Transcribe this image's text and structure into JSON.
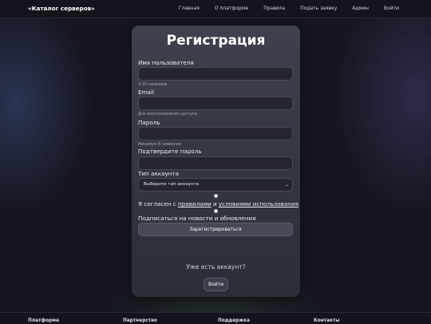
{
  "nav": {
    "brand": "«Каталог серверов»",
    "items": [
      "Главная",
      "О платформе",
      "Правила",
      "Подать заявку",
      "Админ",
      "Войти"
    ]
  },
  "form": {
    "title": "Регистрация",
    "username": {
      "label": "Имя пользователя",
      "hint": "3-20 символов",
      "value": ""
    },
    "email": {
      "label": "Email",
      "hint": "Для восстановления доступа",
      "value": ""
    },
    "password": {
      "label": "Пароль",
      "hint": "Минимум 8 символов",
      "value": ""
    },
    "confirm": {
      "label": "Подтвердите пароль",
      "value": ""
    },
    "account_type": {
      "label": "Тип аккаунта",
      "selected": "Выберите тип аккаунта"
    },
    "agree": {
      "prefix": "Я согласен с ",
      "rules_link": "правилами",
      "middle": " и ",
      "terms_link": "условиями использования",
      "checked": false
    },
    "subscribe": {
      "label": "Подписаться на новости и обновления",
      "checked": false
    },
    "submit_label": "Зарегистрироваться",
    "have_account": "Уже есть аккаунт?",
    "login_label": "Войти"
  },
  "footer": {
    "columns": [
      "Платформа",
      "Партнерство",
      "Поддержка",
      "Контакты"
    ]
  }
}
